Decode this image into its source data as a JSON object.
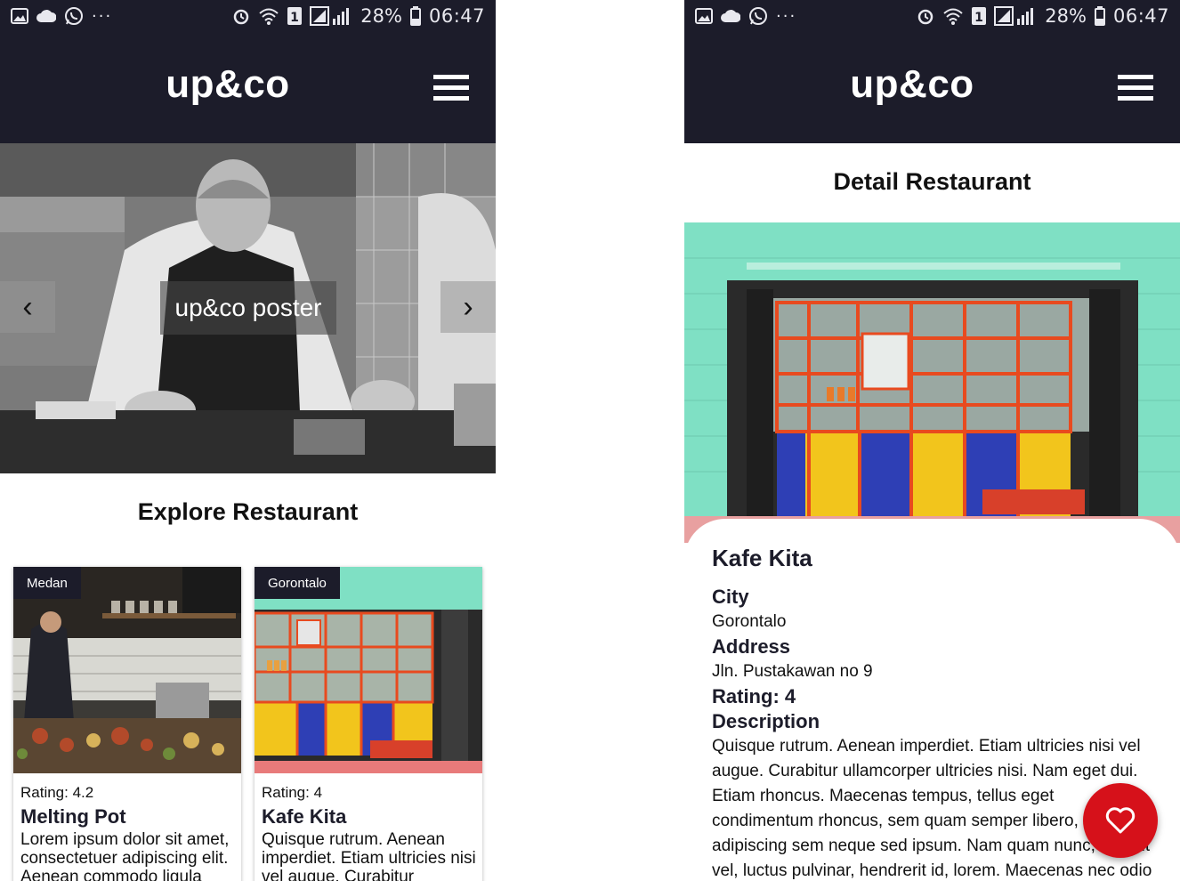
{
  "status_bar": {
    "time": "06:47",
    "battery": "28%",
    "sim_badge": "1",
    "overflow_dots": "···"
  },
  "app": {
    "brand": "up&co"
  },
  "home": {
    "hero_caption": "up&co poster",
    "prev_label": "‹",
    "next_label": "›",
    "section_title": "Explore Restaurant",
    "restaurants": [
      {
        "city": "Medan",
        "rating": "Rating: 4.2",
        "name": "Melting Pot",
        "description": "Lorem ipsum dolor sit amet, consectetuer adipiscing elit. Aenean commodo ligula"
      },
      {
        "city": "Gorontalo",
        "rating": "Rating: 4",
        "name": "Kafe Kita",
        "description": "Quisque rutrum. Aenean imperdiet. Etiam ultricies nisi vel augue. Curabitur"
      }
    ]
  },
  "detail": {
    "page_title": "Detail Restaurant",
    "name": "Kafe Kita",
    "city_label": "City",
    "city": "Gorontalo",
    "address_label": "Address",
    "address": "Jln. Pustakawan no 9",
    "rating_label": "Rating: 4",
    "description_label": "Description",
    "description": "Quisque rutrum. Aenean imperdiet. Etiam ultricies nisi vel augue. Curabitur ullamcorper ultricies nisi. Nam eget dui. Etiam rhoncus. Maecenas tempus, tellus eget condimentum rhoncus, sem quam semper libero, sit amet adipiscing sem neque sed ipsum. Nam quam nunc, blandit vel, luctus pulvinar, hendrerit id, lorem. Maecenas nec odio et ante",
    "fab_icon": "heart-icon"
  },
  "colors": {
    "app_bar": "#1c1c2a",
    "fab": "#d6111a",
    "shop_wall": "#7fe0c4"
  }
}
